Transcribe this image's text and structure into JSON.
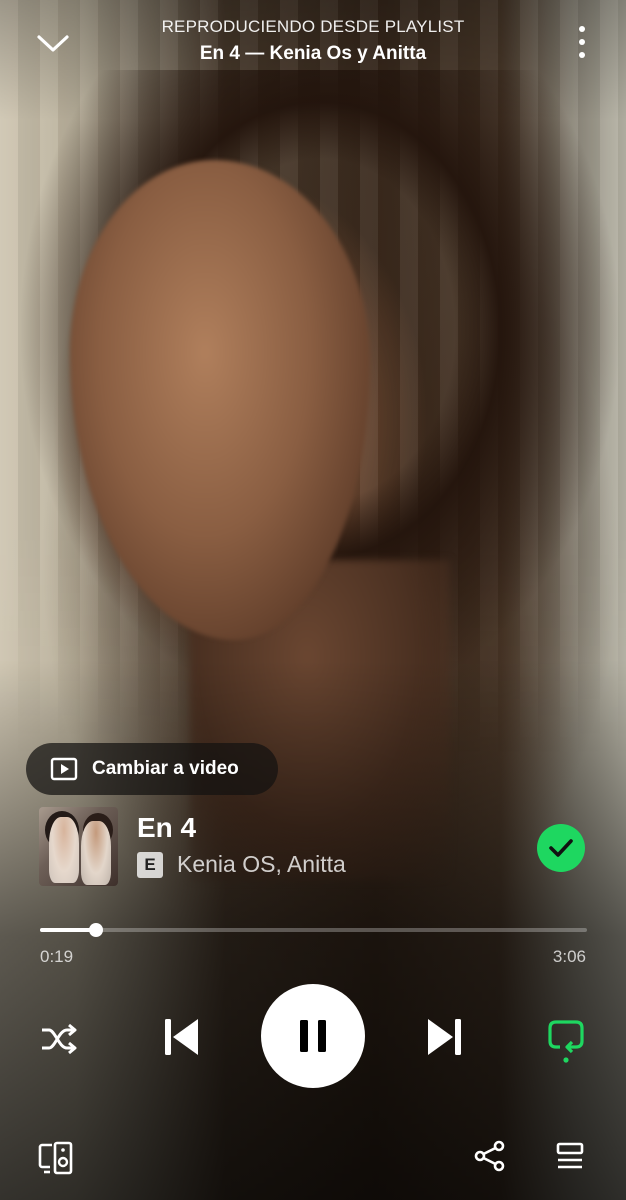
{
  "header": {
    "context_label": "REPRODUCIENDO DESDE PLAYLIST",
    "context_name": "En 4 — Kenia Os y Anitta",
    "collapse_icon": "chevron-down-icon",
    "more_icon": "more-vertical-icon"
  },
  "video_switch": {
    "label": "Cambiar a video",
    "icon": "video-icon"
  },
  "track": {
    "title": "En 4",
    "explicit_badge": "E",
    "artists": "Kenia OS, Anitta",
    "liked": true,
    "liked_icon": "check-circle-icon"
  },
  "progress": {
    "elapsed": "0:19",
    "total": "3:06",
    "fraction": 0.102
  },
  "controls": {
    "shuffle_icon": "shuffle-icon",
    "previous_icon": "skip-previous-icon",
    "play_state_icon": "pause-icon",
    "next_icon": "skip-next-icon",
    "repeat_icon": "repeat-icon",
    "repeat_active": true
  },
  "bottom_bar": {
    "devices_icon": "connect-device-icon",
    "share_icon": "share-icon",
    "queue_icon": "queue-icon"
  },
  "colors": {
    "accent": "#1ed760"
  }
}
